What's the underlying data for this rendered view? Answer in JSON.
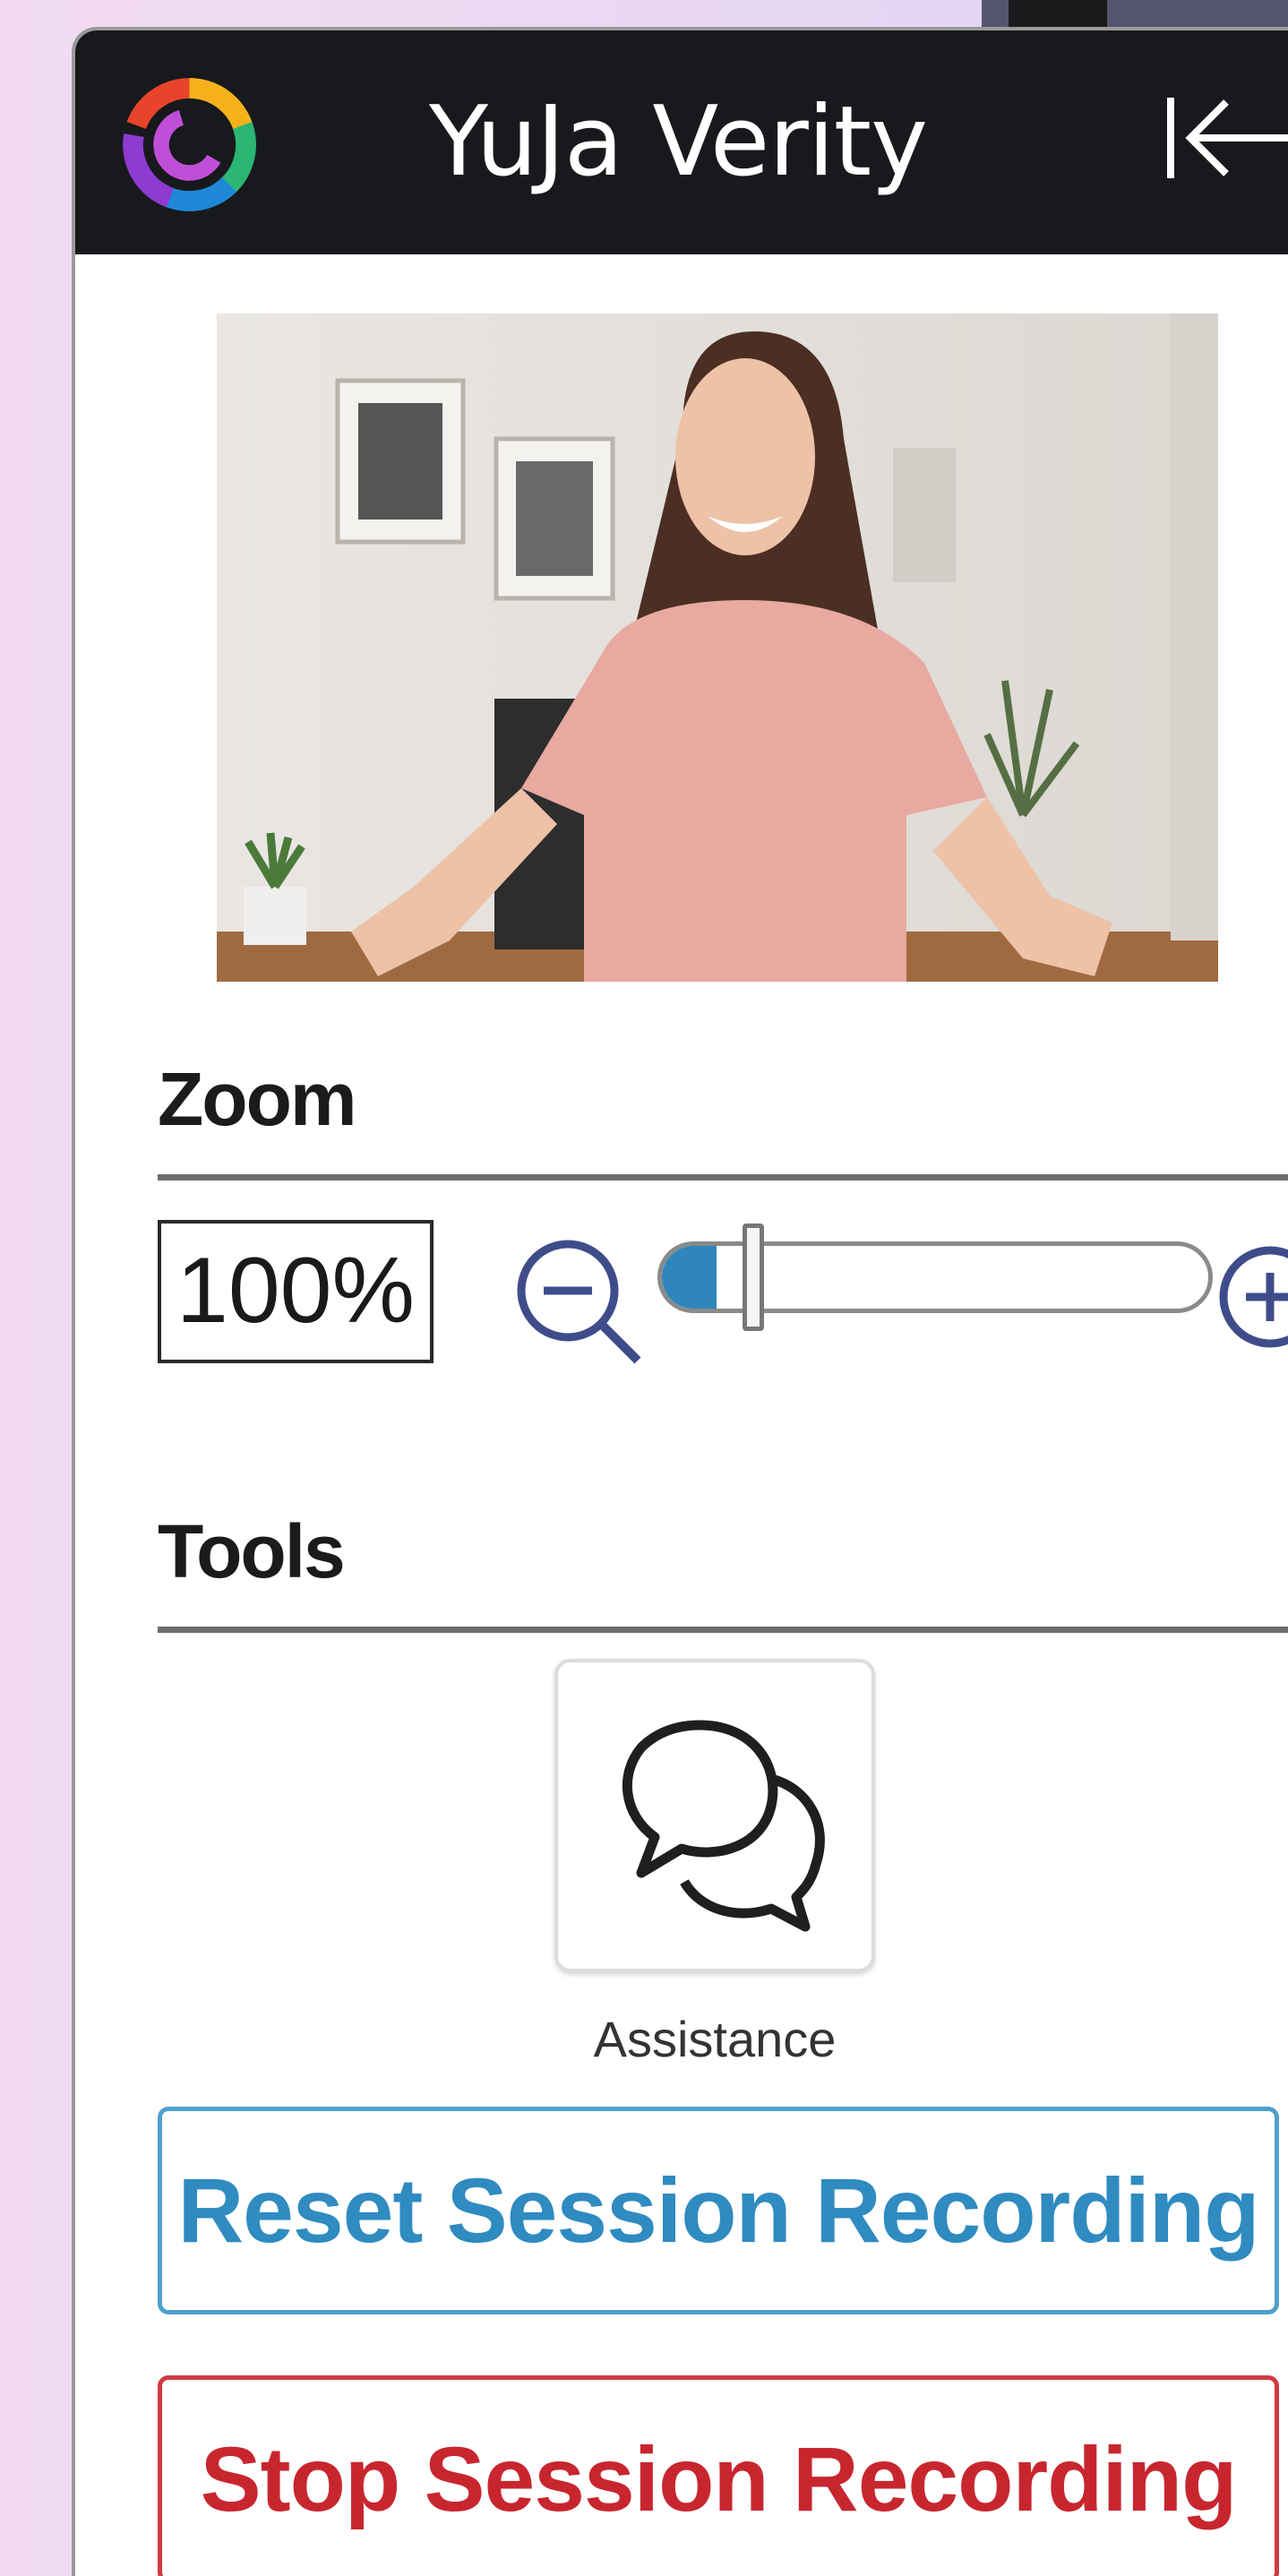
{
  "app": {
    "title": "YuJa Verity"
  },
  "zoom": {
    "heading": "Zoom",
    "value": "100%",
    "level_fraction": 0.1
  },
  "tools": {
    "heading": "Tools",
    "items": [
      {
        "label": "Assistance",
        "icon": "chat-bubbles-icon"
      }
    ]
  },
  "actions": {
    "reset_label": "Reset Session Recording",
    "stop_label": "Stop Session Recording"
  },
  "colors": {
    "titlebar": "#17191d",
    "accent_blue": "#2f8bc0",
    "accent_red": "#c8262f"
  }
}
